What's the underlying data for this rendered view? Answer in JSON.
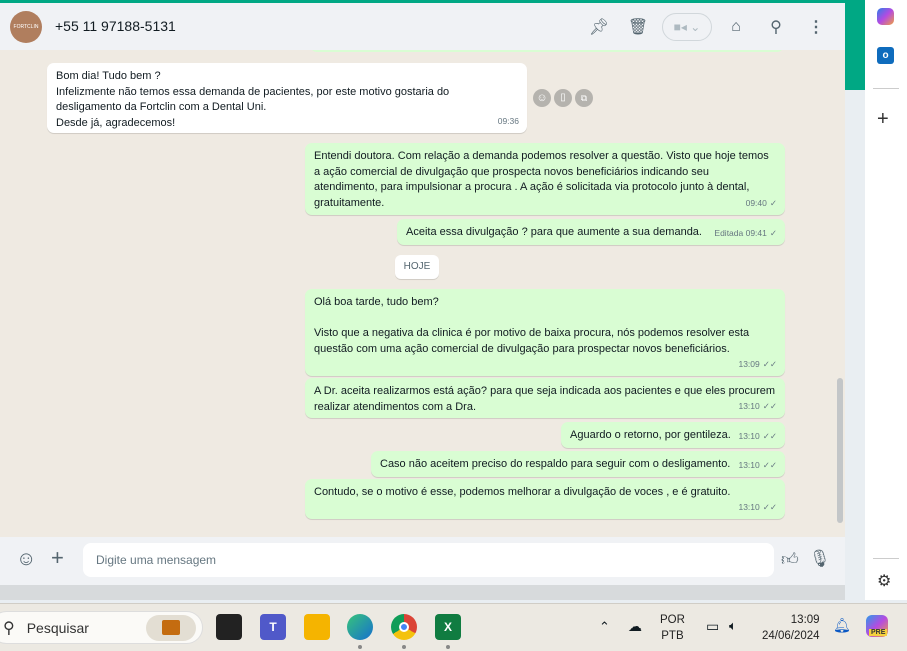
{
  "header": {
    "avatar_text": "FORTCLIN",
    "contact": "+55 11 97188-5131"
  },
  "messages": [
    {
      "dir": "in",
      "lines": [
        "Bom dia! Tudo bem ?",
        "Infelizmente não temos essa demanda de pacientes, por este motivo gostaria do",
        "desligamento da Fortclin com a Dental Uni.",
        "Desde já, agradecemos!"
      ],
      "time": "09:36"
    },
    {
      "dir": "out",
      "lines": [
        "Entendi doutora. Com relação a demanda podemos resolver a questão. Visto que hoje temos",
        "a ação comercial de divulgação que prospecta novos beneficiários indicando seu",
        "atendimento, para impulsionar a procura . A ação é solicitada via protocolo junto à dental,",
        "gratuitamente."
      ],
      "time": "09:40",
      "tick": "✓"
    },
    {
      "dir": "out",
      "lines": [
        "Aceita essa divulgação ? para que aumente a sua demanda."
      ],
      "time": "Editada 09:41",
      "tick": "✓"
    },
    {
      "dir": "out",
      "lines": [
        "Olá boa tarde, tudo bem?",
        "",
        "Visto que a negativa da clinica é por motivo de baixa procura, nós podemos resolver esta",
        "questão com uma ação comercial de divulgação para prospectar novos beneficiários."
      ],
      "time": "13:09",
      "tick": "✓✓"
    },
    {
      "dir": "out",
      "lines": [
        "A Dr. aceita realizarmos está ação? para que seja indicada aos pacientes e que eles procurem",
        "realizar atendimentos com a Dra."
      ],
      "time": "13:10",
      "tick": "✓✓"
    },
    {
      "dir": "out",
      "lines": [
        "Aguardo o retorno, por gentileza."
      ],
      "time": "13:10",
      "tick": "✓✓"
    },
    {
      "dir": "out",
      "lines": [
        "Caso não aceitem preciso do respaldo para seguir com o desligamento."
      ],
      "time": "13:10",
      "tick": "✓✓"
    },
    {
      "dir": "out",
      "lines": [
        "Contudo, se o motivo é esse, podemos melhorar a divulgação de voces , e é gratuito."
      ],
      "time": "13:10",
      "tick": "✓✓"
    }
  ],
  "date_divider": "HOJE",
  "composer": {
    "placeholder": "Digite uma mensagem"
  },
  "taskbar": {
    "search": "Pesquisar",
    "lang1": "POR",
    "lang2": "PTB",
    "time": "13:09",
    "date": "24/06/2024",
    "copilot_badge": "PRE"
  }
}
